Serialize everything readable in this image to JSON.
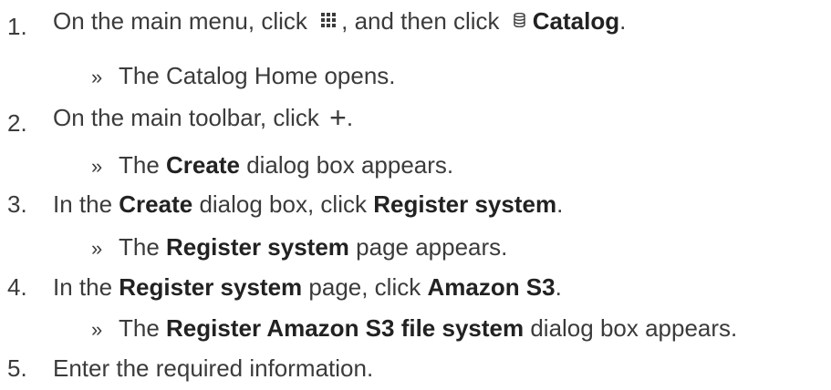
{
  "steps": [
    {
      "number": "1.",
      "parts": {
        "a": "On the main menu, click ",
        "b": ", and then click ",
        "c": "Catalog",
        "d": "."
      },
      "icons": [
        "grid-menu-icon",
        "catalog-database-icon"
      ],
      "result": {
        "a": "The Catalog Home opens."
      }
    },
    {
      "number": "2.",
      "parts": {
        "a": "On the main toolbar, click ",
        "plus": "+",
        "b": "."
      },
      "result": {
        "a": "The ",
        "b": "Create",
        "c": " dialog box appears."
      }
    },
    {
      "number": "3.",
      "parts": {
        "a": "In the ",
        "b": "Create",
        "c": " dialog box, click ",
        "d": "Register system",
        "e": "."
      },
      "result": {
        "a": "The ",
        "b": "Register system",
        "c": " page appears."
      }
    },
    {
      "number": "4.",
      "parts": {
        "a": "In the ",
        "b": "Register system",
        "c": " page, click ",
        "d": "Amazon S3",
        "e": "."
      },
      "result": {
        "a": "The ",
        "b": "Register Amazon S3 file system",
        "c": " dialog box appears."
      }
    },
    {
      "number": "5.",
      "parts": {
        "a": "Enter the required information."
      }
    }
  ],
  "result_marker": "»",
  "colors": {
    "text": "#3b3b3b",
    "emphasis": "#222222",
    "background": "#ffffff"
  }
}
